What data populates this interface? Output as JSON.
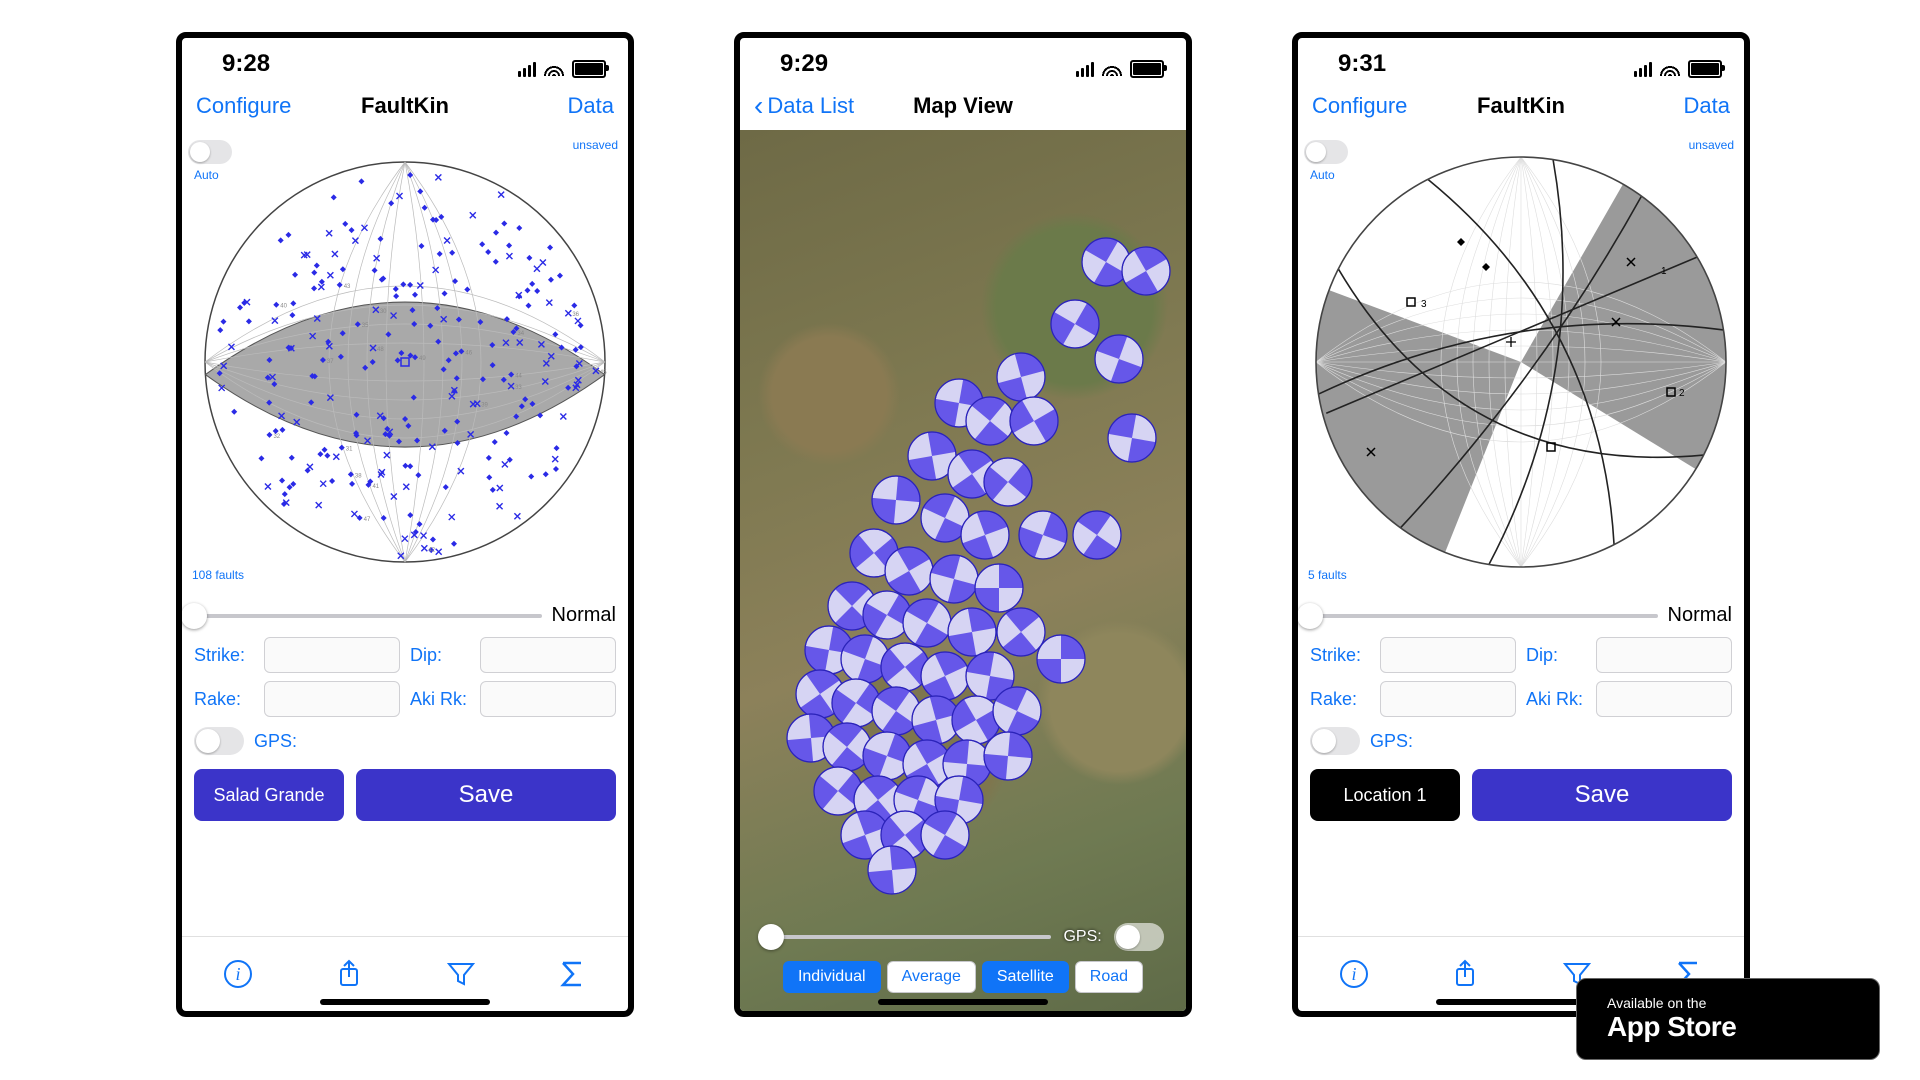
{
  "phone1": {
    "time": "9:28",
    "nav_left": "Configure",
    "nav_title": "FaultKin",
    "nav_right": "Data",
    "unsaved": "unsaved",
    "auto": "Auto",
    "count": "108 faults",
    "slider_caption": "Normal",
    "labels": {
      "strike": "Strike:",
      "dip": "Dip:",
      "rake": "Rake:",
      "aki": "Aki Rk:",
      "gps": "GPS:"
    },
    "btn_left": "Salad Grande",
    "btn_right": "Save"
  },
  "phone2": {
    "time": "9:29",
    "back": "Data List",
    "title": "Map View",
    "gps": "GPS:",
    "seg": [
      "Individual",
      "Average",
      "Satellite",
      "Road"
    ],
    "seg_active": [
      true,
      false,
      true,
      false
    ],
    "markers": [
      {
        "x": 82,
        "y": 15,
        "a": 30
      },
      {
        "x": 91,
        "y": 16,
        "a": 60
      },
      {
        "x": 75,
        "y": 22,
        "a": 120
      },
      {
        "x": 85,
        "y": 26,
        "a": 20
      },
      {
        "x": 63,
        "y": 28,
        "a": 75
      },
      {
        "x": 49,
        "y": 31,
        "a": 100
      },
      {
        "x": 56,
        "y": 33,
        "a": 40
      },
      {
        "x": 66,
        "y": 33,
        "a": 150
      },
      {
        "x": 88,
        "y": 35,
        "a": 10
      },
      {
        "x": 43,
        "y": 37,
        "a": 80
      },
      {
        "x": 52,
        "y": 39,
        "a": 55
      },
      {
        "x": 60,
        "y": 40,
        "a": 130
      },
      {
        "x": 35,
        "y": 42,
        "a": 95
      },
      {
        "x": 46,
        "y": 44,
        "a": 25
      },
      {
        "x": 55,
        "y": 46,
        "a": 70
      },
      {
        "x": 68,
        "y": 46,
        "a": 110
      },
      {
        "x": 80,
        "y": 46,
        "a": 35
      },
      {
        "x": 30,
        "y": 48,
        "a": 140
      },
      {
        "x": 38,
        "y": 50,
        "a": 60
      },
      {
        "x": 48,
        "y": 51,
        "a": 15
      },
      {
        "x": 58,
        "y": 52,
        "a": 90
      },
      {
        "x": 25,
        "y": 54,
        "a": 45
      },
      {
        "x": 33,
        "y": 55,
        "a": 120
      },
      {
        "x": 42,
        "y": 56,
        "a": 30
      },
      {
        "x": 52,
        "y": 57,
        "a": 80
      },
      {
        "x": 63,
        "y": 57,
        "a": 50
      },
      {
        "x": 20,
        "y": 59,
        "a": 100
      },
      {
        "x": 28,
        "y": 60,
        "a": 20
      },
      {
        "x": 37,
        "y": 61,
        "a": 140
      },
      {
        "x": 46,
        "y": 62,
        "a": 65
      },
      {
        "x": 56,
        "y": 62,
        "a": 10
      },
      {
        "x": 72,
        "y": 60,
        "a": 90
      },
      {
        "x": 18,
        "y": 64,
        "a": 55
      },
      {
        "x": 26,
        "y": 65,
        "a": 125
      },
      {
        "x": 35,
        "y": 66,
        "a": 35
      },
      {
        "x": 44,
        "y": 67,
        "a": 75
      },
      {
        "x": 53,
        "y": 67,
        "a": 150
      },
      {
        "x": 62,
        "y": 66,
        "a": 25
      },
      {
        "x": 16,
        "y": 69,
        "a": 85
      },
      {
        "x": 24,
        "y": 70,
        "a": 40
      },
      {
        "x": 33,
        "y": 71,
        "a": 110
      },
      {
        "x": 42,
        "y": 72,
        "a": 60
      },
      {
        "x": 51,
        "y": 72,
        "a": 5
      },
      {
        "x": 60,
        "y": 71,
        "a": 95
      },
      {
        "x": 22,
        "y": 75,
        "a": 130
      },
      {
        "x": 31,
        "y": 76,
        "a": 50
      },
      {
        "x": 40,
        "y": 76,
        "a": 20
      },
      {
        "x": 49,
        "y": 76,
        "a": 100
      },
      {
        "x": 28,
        "y": 80,
        "a": 70
      },
      {
        "x": 37,
        "y": 80,
        "a": 140
      },
      {
        "x": 46,
        "y": 80,
        "a": 30
      },
      {
        "x": 34,
        "y": 84,
        "a": 85
      }
    ]
  },
  "phone3": {
    "time": "9:31",
    "nav_left": "Configure",
    "nav_title": "FaultKin",
    "nav_right": "Data",
    "unsaved": "unsaved",
    "auto": "Auto",
    "count": "5 faults",
    "slider_caption": "Normal",
    "labels": {
      "strike": "Strike:",
      "dip": "Dip:",
      "rake": "Rake:",
      "aki": "Aki Rk:",
      "gps": "GPS:"
    },
    "btn_left": "Location 1",
    "btn_right": "Save"
  },
  "appstore": {
    "line1": "Available on the",
    "line2": "App Store"
  }
}
